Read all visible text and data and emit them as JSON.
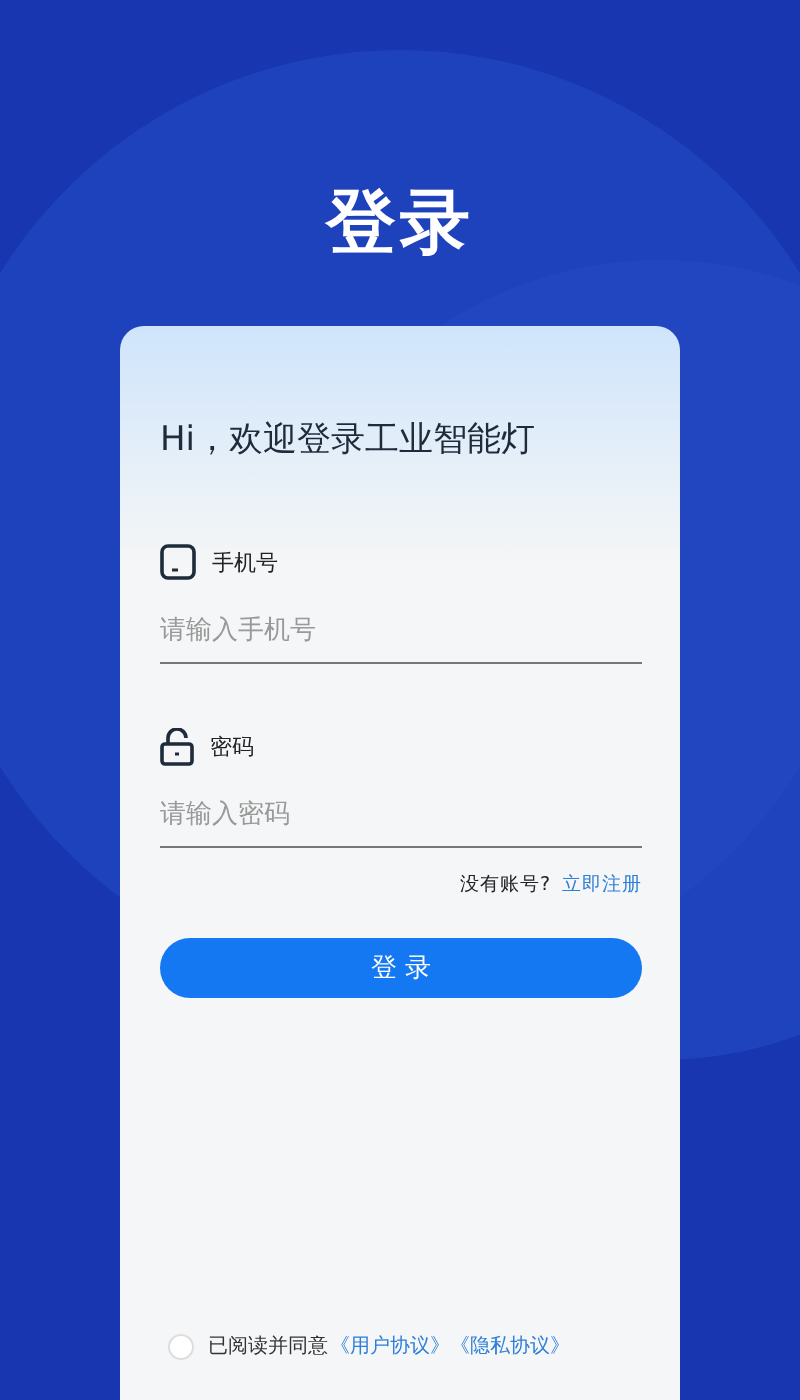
{
  "title": "登录",
  "greeting": "Hi，欢迎登录工业智能灯",
  "fields": [
    {
      "kind": "phone",
      "label": "手机号",
      "placeholder": "请输入手机号"
    },
    {
      "kind": "password",
      "label": "密码",
      "placeholder": "请输入密码"
    }
  ],
  "register": {
    "prompt": "没有账号?",
    "link": "立即注册"
  },
  "login_button": "登 录",
  "agreement": {
    "checked": false,
    "text": "已阅读并同意",
    "links": [
      "《用户协议》",
      "《隐私协议》"
    ]
  }
}
